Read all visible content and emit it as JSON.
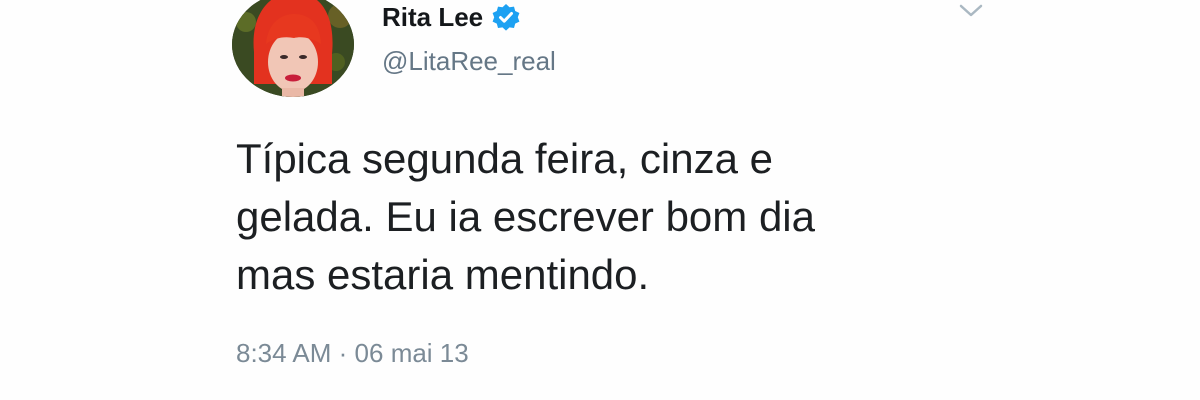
{
  "author": {
    "display_name": "Rita Lee",
    "handle": "@LitaRee_real",
    "verified": true,
    "verified_icon": "verified-badge-icon",
    "avatar": "profile-avatar"
  },
  "menu_icon": "chevron-down-icon",
  "tweet": {
    "lines": [
      "Típica segunda feira, cinza e",
      "gelada. Eu ia escrever bom dia",
      "mas estaria mentindo."
    ],
    "time": "8:34 AM",
    "separator": "·",
    "date": "06 mai 13"
  },
  "colors": {
    "name": "#14171a",
    "handle": "#657786",
    "verified": "#1da1f2",
    "text": "#1c1f22",
    "meta": "#7b8a96"
  }
}
